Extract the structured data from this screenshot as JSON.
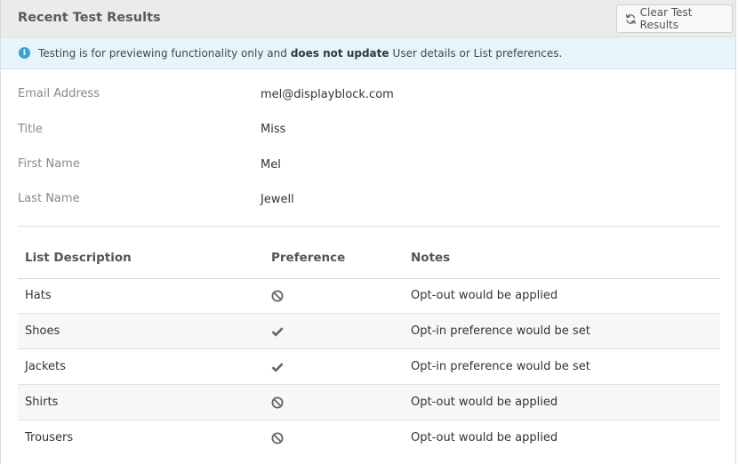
{
  "panel": {
    "title": "Recent Test Results",
    "clear_button": {
      "label": "Clear Test Results",
      "icon": "refresh-icon"
    }
  },
  "info": {
    "icon": "info-icon",
    "text_before": "Testing is for previewing functionality only and",
    "text_bold": "does not update",
    "text_after": "User details or List preferences."
  },
  "fields": [
    {
      "label": "Email Address",
      "value": "mel@displayblock.com"
    },
    {
      "label": "Title",
      "value": "Miss"
    },
    {
      "label": "First Name",
      "value": "Mel"
    },
    {
      "label": "Last Name",
      "value": "Jewell"
    }
  ],
  "table": {
    "headers": {
      "list": "List Description",
      "preference": "Preference",
      "notes": "Notes"
    },
    "rows": [
      {
        "list": "Hats",
        "preference": "opt-out",
        "icon": "ban-icon",
        "notes": "Opt-out would be applied"
      },
      {
        "list": "Shoes",
        "preference": "opt-in",
        "icon": "check-icon",
        "notes": "Opt-in preference would be set"
      },
      {
        "list": "Jackets",
        "preference": "opt-in",
        "icon": "check-icon",
        "notes": "Opt-in preference would be set"
      },
      {
        "list": "Shirts",
        "preference": "opt-out",
        "icon": "ban-icon",
        "notes": "Opt-out would be applied"
      },
      {
        "list": "Trousers",
        "preference": "opt-out",
        "icon": "ban-icon",
        "notes": "Opt-out would be applied"
      }
    ]
  },
  "colors": {
    "header_bg": "#ebebeb",
    "info_bg": "#e7f5fb",
    "info_icon": "#3aa0d6",
    "icon_gray": "#666666"
  }
}
